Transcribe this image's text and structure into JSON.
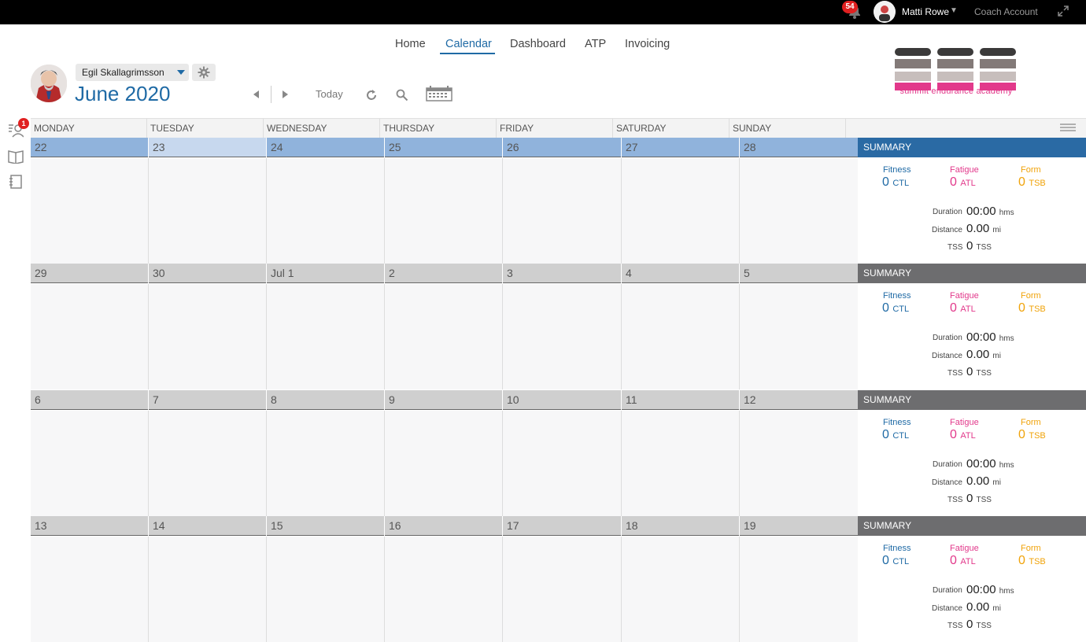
{
  "topbar": {
    "notifications_count": "54",
    "user_name": "Matti Rowe",
    "coach_account": "Coach Account"
  },
  "nav": {
    "items": [
      {
        "label": "Home"
      },
      {
        "label": "Calendar",
        "active": true
      },
      {
        "label": "Dashboard"
      },
      {
        "label": "ATP"
      },
      {
        "label": "Invoicing"
      }
    ]
  },
  "athlete": {
    "selected": "Egil Skallagrimsson"
  },
  "calendar": {
    "month_title": "June 2020",
    "today_label": "Today",
    "side_badge": "1",
    "weekdays": [
      "MONDAY",
      "TUESDAY",
      "WEDNESDAY",
      "THURSDAY",
      "FRIDAY",
      "SATURDAY",
      "SUNDAY"
    ],
    "weeks": [
      {
        "days": [
          "22",
          "23",
          "24",
          "25",
          "26",
          "27",
          "28"
        ],
        "current": true
      },
      {
        "days": [
          "29",
          "30",
          "Jul 1",
          "2",
          "3",
          "4",
          "5"
        ],
        "current": false
      },
      {
        "days": [
          "6",
          "7",
          "8",
          "9",
          "10",
          "11",
          "12"
        ],
        "current": false
      },
      {
        "days": [
          "13",
          "14",
          "15",
          "16",
          "17",
          "18",
          "19"
        ],
        "current": false
      }
    ]
  },
  "summary": {
    "title": "SUMMARY",
    "fitness_label": "Fitness",
    "fatigue_label": "Fatigue",
    "form_label": "Form",
    "fitness_value": "0",
    "fitness_unit": "CTL",
    "fatigue_value": "0",
    "fatigue_unit": "ATL",
    "form_value": "0",
    "form_unit": "TSB",
    "duration_label": "Duration",
    "duration_value": "00:00",
    "duration_unit": "hms",
    "distance_label": "Distance",
    "distance_value": "0.00",
    "distance_unit": "mi",
    "tss_label": "TSS",
    "tss_value": "0",
    "tss_unit": "TSS"
  },
  "brand": {
    "tagline": "summit endurance academy"
  },
  "colors": {
    "accent": "#1f6aa5",
    "fatigue": "#e2398b",
    "form": "#f0a30a",
    "current_week_head": "#90b3dc",
    "week_head": "#cfcfcf",
    "summary_current": "#2a6aa4",
    "summary_other": "#6d6d6f"
  }
}
